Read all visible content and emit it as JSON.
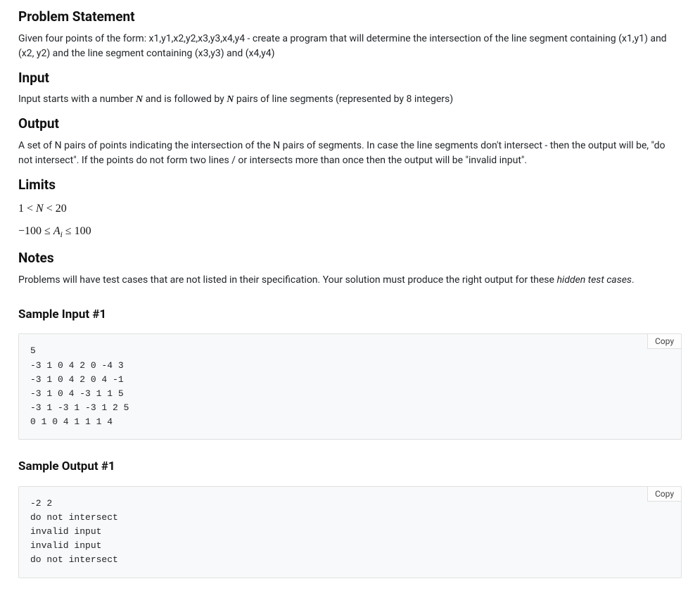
{
  "headings": {
    "problem_statement": "Problem Statement",
    "input": "Input",
    "output": "Output",
    "limits": "Limits",
    "notes": "Notes",
    "sample_input_1": "Sample Input #1",
    "sample_output_1": "Sample Output #1"
  },
  "paragraphs": {
    "problem_statement": "Given four points of the form: x1,y1,x2,y2,x3,y3,x4,y4 - create a program that will determine the intersection of the line segment containing (x1,y1) and (x2, y2) and the line segment containing (x3,y3) and (x4,y4)",
    "input_prefix": "Input starts with a number ",
    "input_mid": " and is followed by ",
    "input_suffix": " pairs of line segments (represented by 8 integers)",
    "output": "A set of N pairs of points indicating the intersection of the N pairs of segments. In case the line segments don't intersect - then the output will be, \"do not intersect\". If the points do not form two lines / or intersects more than once then the output will be \"invalid input\".",
    "notes_prefix": "Problems will have test cases that are not listed in their specification. Your solution must produce the right output for these ",
    "notes_italic": "hidden test cases",
    "notes_suffix": "."
  },
  "math": {
    "N": "N",
    "limit1_a": "1",
    "limit1_op1": "<",
    "limit1_mid": "N",
    "limit1_op2": "<",
    "limit1_b": "20",
    "limit2_a": "−100",
    "limit2_op1": "≤",
    "limit2_mid": "A",
    "limit2_sub": "i",
    "limit2_op2": "≤",
    "limit2_b": "100"
  },
  "buttons": {
    "copy": "Copy"
  },
  "samples": {
    "input1": "5\n-3 1 0 4 2 0 -4 3\n-3 1 0 4 2 0 4 -1\n-3 1 0 4 -3 1 1 5\n-3 1 -3 1 -3 1 2 5\n0 1 0 4 1 1 1 4",
    "output1": "-2 2\ndo not intersect\ninvalid input\ninvalid input\ndo not intersect"
  }
}
